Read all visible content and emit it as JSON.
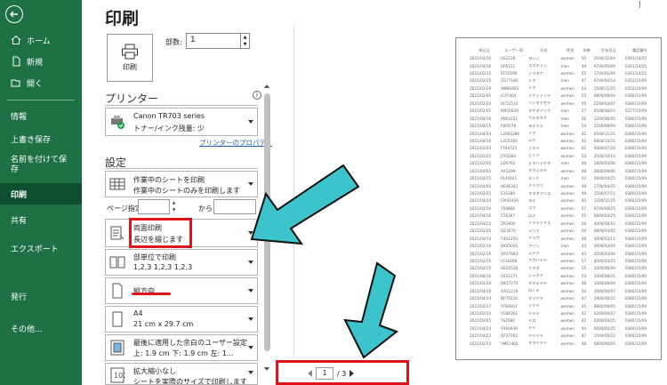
{
  "sidebar": {
    "items": [
      {
        "label": "ホーム",
        "icon": "home-icon"
      },
      {
        "label": "新規",
        "icon": "new-document-icon"
      },
      {
        "label": "開く",
        "icon": "folder-open-icon"
      },
      {
        "label": "情報"
      },
      {
        "label": "上書き保存"
      },
      {
        "label": "名前を付けて保存"
      },
      {
        "label": "印刷",
        "active": true
      },
      {
        "label": "共有"
      },
      {
        "label": "エクスポート"
      },
      {
        "label": "発行"
      },
      {
        "label": "その他..."
      }
    ]
  },
  "page": {
    "title": "印刷"
  },
  "print": {
    "button_label": "印刷",
    "copies_label": "部数:",
    "copies_value": "1"
  },
  "printer": {
    "heading": "プリンター",
    "name": "Canon TR703 series",
    "status": "トナー/インク残量: 少",
    "properties_link": "プリンターのプロパティ"
  },
  "settings": {
    "heading": "設定",
    "what": {
      "line1": "作業中のシートを印刷",
      "line2": "作業中のシートのみを印刷します"
    },
    "pages_label": "ページ指定:",
    "pages_to": "から",
    "duplex": {
      "line1": "両面印刷",
      "line2": "長辺を綴じます"
    },
    "collate": {
      "line1": "部単位で印刷",
      "line2": "1,2,3    1,2,3    1,2,3"
    },
    "orientation": {
      "line1": "縦方向"
    },
    "paper": {
      "line1": "A4",
      "line2": "21 cm x 29.7 cm"
    },
    "margins": {
      "line1": "最後に適用した余白のユーザー設定",
      "line2": "上: 1.9 cm 下: 1.9 cm 左: 1..."
    },
    "scaling": {
      "line1": "拡大縮小なし",
      "line2": "シートを実際のサイズで印刷します"
    }
  },
  "nav": {
    "current": "1",
    "total": "/ 3"
  },
  "colors": {
    "sidebar": "#1e7145",
    "highlight": "#e0121b",
    "arrow": "#3cc4cc"
  },
  "preview": {
    "headers": [
      "申込日",
      "ユーザーID",
      "氏名",
      "性別",
      "年齢",
      "生年月日",
      "電話番号"
    ],
    "rows": [
      [
        "2021/04/16",
        "US2128",
        "ヨシノ",
        "women",
        "55",
        "2000/11/04",
        "0391/14/25"
      ],
      [
        "2021/04/16",
        "UP5511",
        "スズキトシ",
        "men",
        "49",
        "0700/05/09",
        "0391/14/25"
      ],
      [
        "2021/02/15",
        "EF55596",
        "シマタケ",
        "women",
        "55",
        "1700/01/09",
        "0391/14/25"
      ],
      [
        "2021/02/25",
        "ZG77182",
        "ミオ",
        "men",
        "47",
        "0700/04/14",
        "0352/15/09"
      ],
      [
        "2021/02/29",
        "AW84462",
        "ミオ",
        "women",
        "54",
        "1500/11/25",
        "0352/15/09"
      ],
      [
        "2021/02/05",
        "IC47404",
        "ミナトトリヤ",
        "women",
        "55",
        "0800/08/04",
        "0380/11/09"
      ],
      [
        "2021/02/25",
        "UC52512",
        "ヘトモヤモヤ",
        "women",
        "55",
        "2200/03/07",
        "0380/15/09"
      ],
      [
        "2021/02/05",
        "KM31629",
        "タケダミツク",
        "men",
        "27",
        "0500/08/15",
        "0377/15/09"
      ],
      [
        "2021/04/16",
        "PN54151",
        "ウキタタケ",
        "men",
        "56",
        "1200/06/05",
        "0380/15/09"
      ],
      [
        "2021/04/15",
        "PJ05078",
        "ヨキヤキ",
        "men",
        "54",
        "2500/08/09",
        "0380/15/09"
      ],
      [
        "2021/04/24",
        "L2065286",
        "ミオ",
        "women",
        "42",
        "0500/11/25",
        "0380/15/09"
      ],
      [
        "2021/04/16",
        "L2U5300",
        "ムヤ",
        "women",
        "42",
        "0800/10/25",
        "0380/15/09"
      ],
      [
        "2021/02/24",
        "FY44725",
        "ミタヤ",
        "women",
        "62",
        "4000/07/28",
        "0380/15/09"
      ],
      [
        "2021/02/25",
        "JT65284",
        "ヒトミ",
        "women",
        "54",
        "2000/10/14",
        "0380/15/09"
      ],
      [
        "2021/02/05",
        "LD0792",
        "キタハヤチタ",
        "men",
        "48",
        "1800/03/08",
        "0380/15/09"
      ],
      [
        "2021/04/05",
        "AX3299",
        "タカムラヤ",
        "women",
        "48",
        "0800/09/06",
        "0380/15/09"
      ],
      [
        "2021/04/15",
        "PL44441",
        "タンケ",
        "men",
        "52",
        "0800/04/25",
        "0380/15/09"
      ],
      [
        "2021/04/05",
        "HE46342",
        "ミヤマツ",
        "women",
        "48",
        "1700/04/25",
        "0380/15/09"
      ],
      [
        "2021/02/25",
        "E1S380",
        "ホタタマリユ",
        "women",
        "49",
        "1500/07/11",
        "0380/15/09"
      ],
      [
        "2021/04/24",
        "CM30439",
        "ヨキ",
        "women",
        "45",
        "1200/11/25",
        "0380/15/09"
      ],
      [
        "2021/02/10",
        "Y50868",
        "コマ",
        "women",
        "57",
        "0700/08/25",
        "0380/15/09"
      ],
      [
        "2021/04/16",
        "C5S347",
        "ロキ",
        "women",
        "55",
        "0800/04/25",
        "0380/15/09"
      ],
      [
        "2021/04/23",
        "ZR3900",
        "ミヤヤミヤス",
        "women",
        "56",
        "4000/08/10",
        "0380/15/09"
      ],
      [
        "2021/02/25",
        "QZ3070",
        "メリヤ",
        "women",
        "50",
        "0800/03/05",
        "0380/15/09"
      ],
      [
        "2021/04/14",
        "Y3U1250",
        "ヤマウ",
        "women",
        "48",
        "4900/03/11",
        "0380/15/09"
      ],
      [
        "2021/02/16",
        "BX45005",
        "アリン",
        "men",
        "43",
        "4900/03/09",
        "0380/15/09"
      ],
      [
        "2021/02/16",
        "OP37683",
        "ムヤヤ",
        "women",
        "43",
        "4500/03/04",
        "0380/15/09"
      ],
      [
        "2021/02/15",
        "LF30408",
        "アカハヤヤ",
        "women",
        "57",
        "4000/03/25",
        "0380/15/09"
      ],
      [
        "2021/02/25",
        "HE2S518",
        "ミタタ",
        "women",
        "55",
        "1000/06/09",
        "0380/15/09"
      ],
      [
        "2021/06/16",
        "V2S1271",
        "シュカヤ",
        "women",
        "54",
        "1900/08/25",
        "0380/15/09"
      ],
      [
        "2021/02/26",
        "DK57275",
        "タタキヤヤ",
        "women",
        "48",
        "1000/06/09",
        "0380/15/09"
      ],
      [
        "2021/04/16",
        "AA51218",
        "ロトキ",
        "women",
        "50",
        "1900/06/07",
        "0380/15/09"
      ],
      [
        "2021/04/14",
        "NF70224",
        "タマヤヤ",
        "women",
        "47",
        "1900/06/25",
        "0380/15/09"
      ],
      [
        "2021/02/17",
        "YF84603",
        "ミヤヤ",
        "women",
        "45",
        "0800/09/05",
        "0380/15/09"
      ],
      [
        "2021/02/14",
        "YG80261",
        "ヤヤヤ",
        "women",
        "42",
        "0200/04/07",
        "0380/15/09"
      ],
      [
        "2021/02/05",
        "YS2680",
        "ヤロ",
        "women",
        "42",
        "0200/04/25",
        "0380/15/09"
      ],
      [
        "2021/04/24",
        "YX93939",
        "ヤヤ",
        "women",
        "44",
        "0000/00/25",
        "0380/15/09"
      ],
      [
        "2021/04/22",
        "QF37202",
        "ヤヤヤヤ",
        "women",
        "47",
        "1500/00/12",
        "0380/15/09"
      ],
      [
        "2021/02/23",
        "YME1402",
        "ホタヤヤヤ",
        "women",
        "48",
        "0800/00/05",
        "0380/15/09"
      ]
    ]
  }
}
